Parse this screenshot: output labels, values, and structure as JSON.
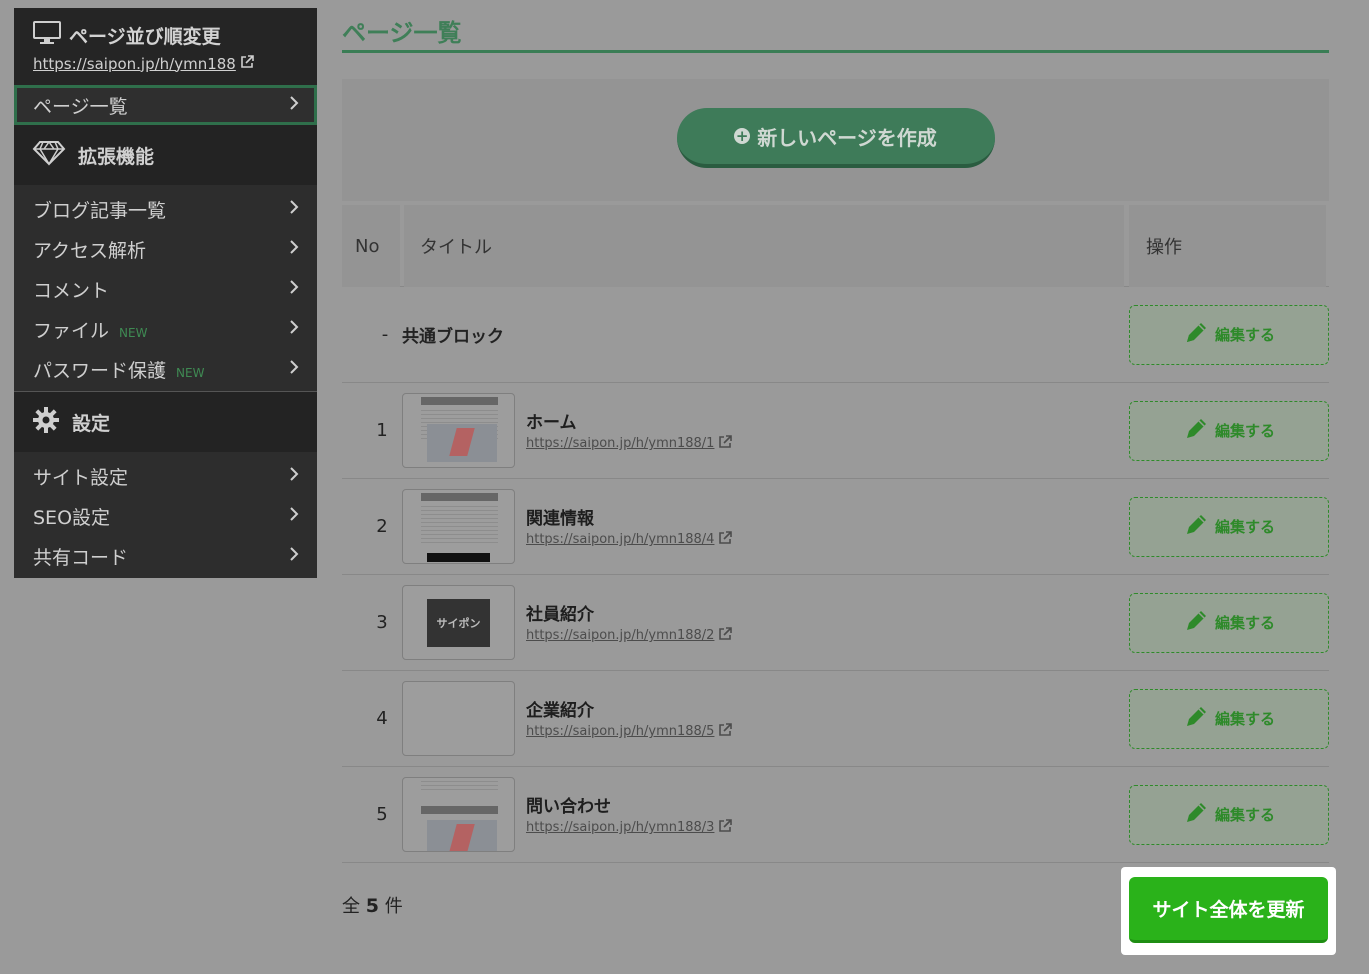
{
  "sidebar": {
    "header": {
      "title": "ページ並び順変更",
      "url": "https://saipon.jp/h/ymn188"
    },
    "active_item": "ページ一覧",
    "extensions": {
      "title": "拡張機能",
      "items": [
        {
          "label": "ブログ記事一覧",
          "badge": ""
        },
        {
          "label": "アクセス解析",
          "badge": ""
        },
        {
          "label": "コメント",
          "badge": ""
        },
        {
          "label": "ファイル",
          "badge": "NEW"
        },
        {
          "label": "パスワード保護",
          "badge": "NEW"
        }
      ]
    },
    "settings": {
      "title": "設定",
      "items": [
        {
          "label": "サイト設定"
        },
        {
          "label": "SEO設定"
        },
        {
          "label": "共有コード"
        }
      ]
    }
  },
  "main": {
    "title": "ページ一覧",
    "create_button": "新しいページを作成",
    "table": {
      "headers": {
        "no": "No",
        "title": "タイトル",
        "op": "操作"
      },
      "common_block": {
        "no": "-",
        "title": "共通ブロック",
        "edit": "編集する"
      },
      "rows": [
        {
          "no": "1",
          "title": "ホーム",
          "url": "https://saipon.jp/h/ymn188/1",
          "thumb": "map",
          "edit": "編集する"
        },
        {
          "no": "2",
          "title": "関連情報",
          "url": "https://saipon.jp/h/ymn188/4",
          "thumb": "list",
          "edit": "編集する"
        },
        {
          "no": "3",
          "title": "社員紹介",
          "url": "https://saipon.jp/h/ymn188/2",
          "thumb": "dark",
          "thumb_text": "サイポン",
          "edit": "編集する"
        },
        {
          "no": "4",
          "title": "企業紹介",
          "url": "https://saipon.jp/h/ymn188/5",
          "thumb": "blank",
          "edit": "編集する"
        },
        {
          "no": "5",
          "title": "問い合わせ",
          "url": "https://saipon.jp/h/ymn188/3",
          "thumb": "map2",
          "edit": "編集する"
        }
      ]
    },
    "footer": {
      "count_prefix": "全",
      "count": "5",
      "count_suffix": "件",
      "update_button": "サイト全体を更新"
    }
  },
  "colors": {
    "accent": "#3a7d55",
    "update": "#2ab21a",
    "edit": "#2e8a2a"
  }
}
